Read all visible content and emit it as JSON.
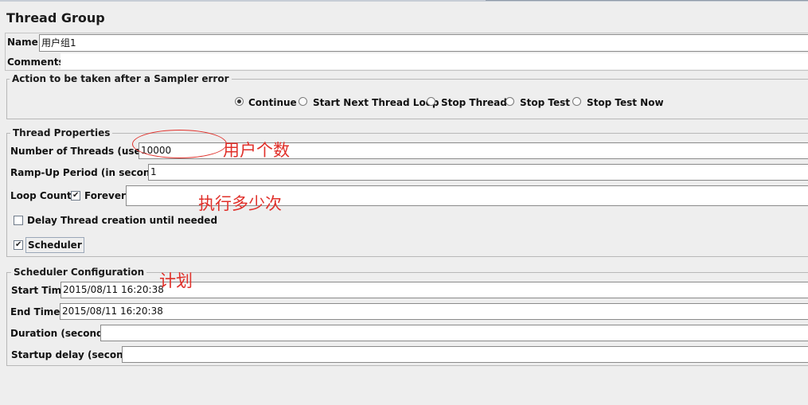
{
  "title": "Thread Group",
  "name_label": "Name:",
  "name_value": "用户组1",
  "comments_label": "Comments:",
  "comments_value": "",
  "sampler_error": {
    "title": "Action to be taken after a Sampler error",
    "options": [
      {
        "label": "Continue",
        "selected": true
      },
      {
        "label": "Start Next Thread Loop",
        "selected": false
      },
      {
        "label": "Stop Thread",
        "selected": false
      },
      {
        "label": "Stop Test",
        "selected": false
      },
      {
        "label": "Stop Test Now",
        "selected": false
      }
    ]
  },
  "thread_properties": {
    "title": "Thread Properties",
    "threads_label": "Number of Threads (users):",
    "threads_value": "10000",
    "rampup_label": "Ramp-Up Period (in seconds):",
    "rampup_value": "1",
    "loop_label": "Loop Count:",
    "forever_label": "Forever",
    "forever_checked": true,
    "loop_value": "",
    "delay_label": "Delay Thread creation until needed",
    "delay_checked": false,
    "scheduler_label": "Scheduler",
    "scheduler_checked": true
  },
  "scheduler_config": {
    "title": "Scheduler Configuration",
    "start_label": "Start Time",
    "start_value": "2015/08/11 16:20:38",
    "end_label": "End Time",
    "end_value": "2015/08/11 16:20:38",
    "duration_label": "Duration (seconds)",
    "duration_value": "",
    "startup_label": "Startup delay (seconds)",
    "startup_value": ""
  },
  "annotations": {
    "users": "用户个数",
    "loops": "执行多少次",
    "plan": "计划"
  },
  "colors": {
    "annotation": "#e0302a",
    "background": "#eeeeee"
  }
}
